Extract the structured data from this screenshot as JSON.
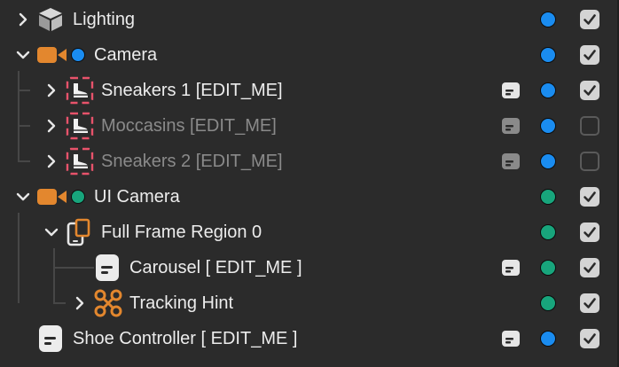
{
  "rows": [
    {
      "label": "Lighting",
      "dot": "blue",
      "checked": true
    },
    {
      "label": "Camera",
      "dot": "blue",
      "checked": true
    },
    {
      "label": "Sneakers 1 [EDIT_ME]",
      "dot": "blue",
      "checked": true
    },
    {
      "label": "Moccasins [EDIT_ME]",
      "dot": "blue",
      "checked": false
    },
    {
      "label": "Sneakers 2 [EDIT_ME]",
      "dot": "blue",
      "checked": false
    },
    {
      "label": "UI Camera",
      "dot": "green",
      "checked": true
    },
    {
      "label": "Full Frame Region 0",
      "dot": "green",
      "checked": true
    },
    {
      "label": "Carousel [ EDIT_ME ]",
      "dot": "green",
      "checked": true
    },
    {
      "label": "Tracking Hint",
      "dot": "green",
      "checked": true
    },
    {
      "label": "Shoe Controller [ EDIT_ME ]",
      "dot": "blue",
      "checked": true
    }
  ],
  "colors": {
    "blue": "#1a8cf0",
    "green": "#18a57c",
    "camera_orange": "#e3872e",
    "sneaker_red": "#e8536b"
  }
}
